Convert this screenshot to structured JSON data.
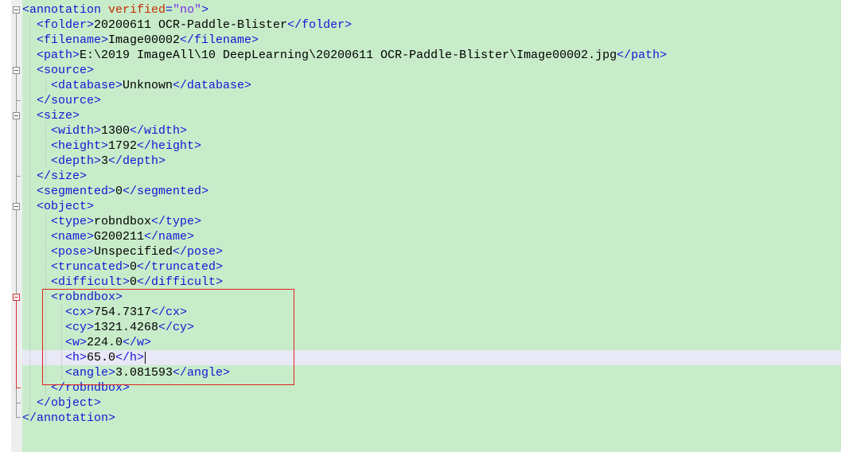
{
  "document": {
    "lines": [
      {
        "parts": [
          {
            "c": "tag",
            "t": "<annotation "
          },
          {
            "c": "attr",
            "t": "verified"
          },
          {
            "c": "tag",
            "t": "="
          },
          {
            "c": "val",
            "t": "\"no\""
          },
          {
            "c": "tag",
            "t": ">"
          }
        ]
      },
      {
        "parts": [
          {
            "c": "tag",
            "t": "  <folder>"
          },
          {
            "c": "txt",
            "t": "20200611 OCR-Paddle-Blister"
          },
          {
            "c": "tag",
            "t": "</folder>"
          }
        ]
      },
      {
        "parts": [
          {
            "c": "tag",
            "t": "  <filename>"
          },
          {
            "c": "txt",
            "t": "Image00002"
          },
          {
            "c": "tag",
            "t": "</filename>"
          }
        ]
      },
      {
        "parts": [
          {
            "c": "tag",
            "t": "  <path>"
          },
          {
            "c": "txt",
            "t": "E:\\2019 ImageAll\\10 DeepLearning\\20200611 OCR-Paddle-Blister\\Image00002.jpg"
          },
          {
            "c": "tag",
            "t": "</path>"
          }
        ]
      },
      {
        "parts": [
          {
            "c": "tag",
            "t": "  <source>"
          }
        ]
      },
      {
        "parts": [
          {
            "c": "tag",
            "t": "    <database>"
          },
          {
            "c": "txt",
            "t": "Unknown"
          },
          {
            "c": "tag",
            "t": "</database>"
          }
        ]
      },
      {
        "parts": [
          {
            "c": "tag",
            "t": "  </source>"
          }
        ]
      },
      {
        "parts": [
          {
            "c": "tag",
            "t": "  <size>"
          }
        ]
      },
      {
        "parts": [
          {
            "c": "tag",
            "t": "    <width>"
          },
          {
            "c": "txt",
            "t": "1300"
          },
          {
            "c": "tag",
            "t": "</width>"
          }
        ]
      },
      {
        "parts": [
          {
            "c": "tag",
            "t": "    <height>"
          },
          {
            "c": "txt",
            "t": "1792"
          },
          {
            "c": "tag",
            "t": "</height>"
          }
        ]
      },
      {
        "parts": [
          {
            "c": "tag",
            "t": "    <depth>"
          },
          {
            "c": "txt",
            "t": "3"
          },
          {
            "c": "tag",
            "t": "</depth>"
          }
        ]
      },
      {
        "parts": [
          {
            "c": "tag",
            "t": "  </size>"
          }
        ]
      },
      {
        "parts": [
          {
            "c": "tag",
            "t": "  <segmented>"
          },
          {
            "c": "txt",
            "t": "0"
          },
          {
            "c": "tag",
            "t": "</segmented>"
          }
        ]
      },
      {
        "parts": [
          {
            "c": "tag",
            "t": "  <object>"
          }
        ]
      },
      {
        "parts": [
          {
            "c": "tag",
            "t": "    <type>"
          },
          {
            "c": "txt",
            "t": "robndbox"
          },
          {
            "c": "tag",
            "t": "</type>"
          }
        ]
      },
      {
        "parts": [
          {
            "c": "tag",
            "t": "    <name>"
          },
          {
            "c": "txt",
            "t": "G200211"
          },
          {
            "c": "tag",
            "t": "</name>"
          }
        ]
      },
      {
        "parts": [
          {
            "c": "tag",
            "t": "    <pose>"
          },
          {
            "c": "txt",
            "t": "Unspecified"
          },
          {
            "c": "tag",
            "t": "</pose>"
          }
        ]
      },
      {
        "parts": [
          {
            "c": "tag",
            "t": "    <truncated>"
          },
          {
            "c": "txt",
            "t": "0"
          },
          {
            "c": "tag",
            "t": "</truncated>"
          }
        ]
      },
      {
        "parts": [
          {
            "c": "tag",
            "t": "    <difficult>"
          },
          {
            "c": "txt",
            "t": "0"
          },
          {
            "c": "tag",
            "t": "</difficult>"
          }
        ]
      },
      {
        "parts": [
          {
            "c": "tag",
            "t": "    <robndbox>"
          }
        ]
      },
      {
        "parts": [
          {
            "c": "tag",
            "t": "      <cx>"
          },
          {
            "c": "txt",
            "t": "754.7317"
          },
          {
            "c": "tag",
            "t": "</cx>"
          }
        ]
      },
      {
        "parts": [
          {
            "c": "tag",
            "t": "      <cy>"
          },
          {
            "c": "txt",
            "t": "1321.4268"
          },
          {
            "c": "tag",
            "t": "</cy>"
          }
        ]
      },
      {
        "parts": [
          {
            "c": "tag",
            "t": "      <w>"
          },
          {
            "c": "txt",
            "t": "224.0"
          },
          {
            "c": "tag",
            "t": "</w>"
          }
        ]
      },
      {
        "parts": [
          {
            "c": "tag",
            "t": "      <h>"
          },
          {
            "c": "txt",
            "t": "65.0"
          },
          {
            "c": "tag",
            "t": "</h>"
          }
        ]
      },
      {
        "parts": [
          {
            "c": "tag",
            "t": "      <angle>"
          },
          {
            "c": "txt",
            "t": "3.081593"
          },
          {
            "c": "tag",
            "t": "</angle>"
          }
        ]
      },
      {
        "parts": [
          {
            "c": "tag",
            "t": "    </robndbox>"
          }
        ]
      },
      {
        "parts": [
          {
            "c": "tag",
            "t": "  </object>"
          }
        ]
      },
      {
        "parts": [
          {
            "c": "tag",
            "t": "</annotation>"
          }
        ]
      }
    ]
  },
  "colors": {
    "background": "#c8ecc9",
    "tag": "#1515d6",
    "attribute": "#c42d00",
    "attribute_value": "#7a2be0",
    "text": "#000000",
    "current_line": "#e8e8f6",
    "selection_box": "#e02020"
  },
  "icons": {
    "fold_open": "minus-box-icon"
  }
}
